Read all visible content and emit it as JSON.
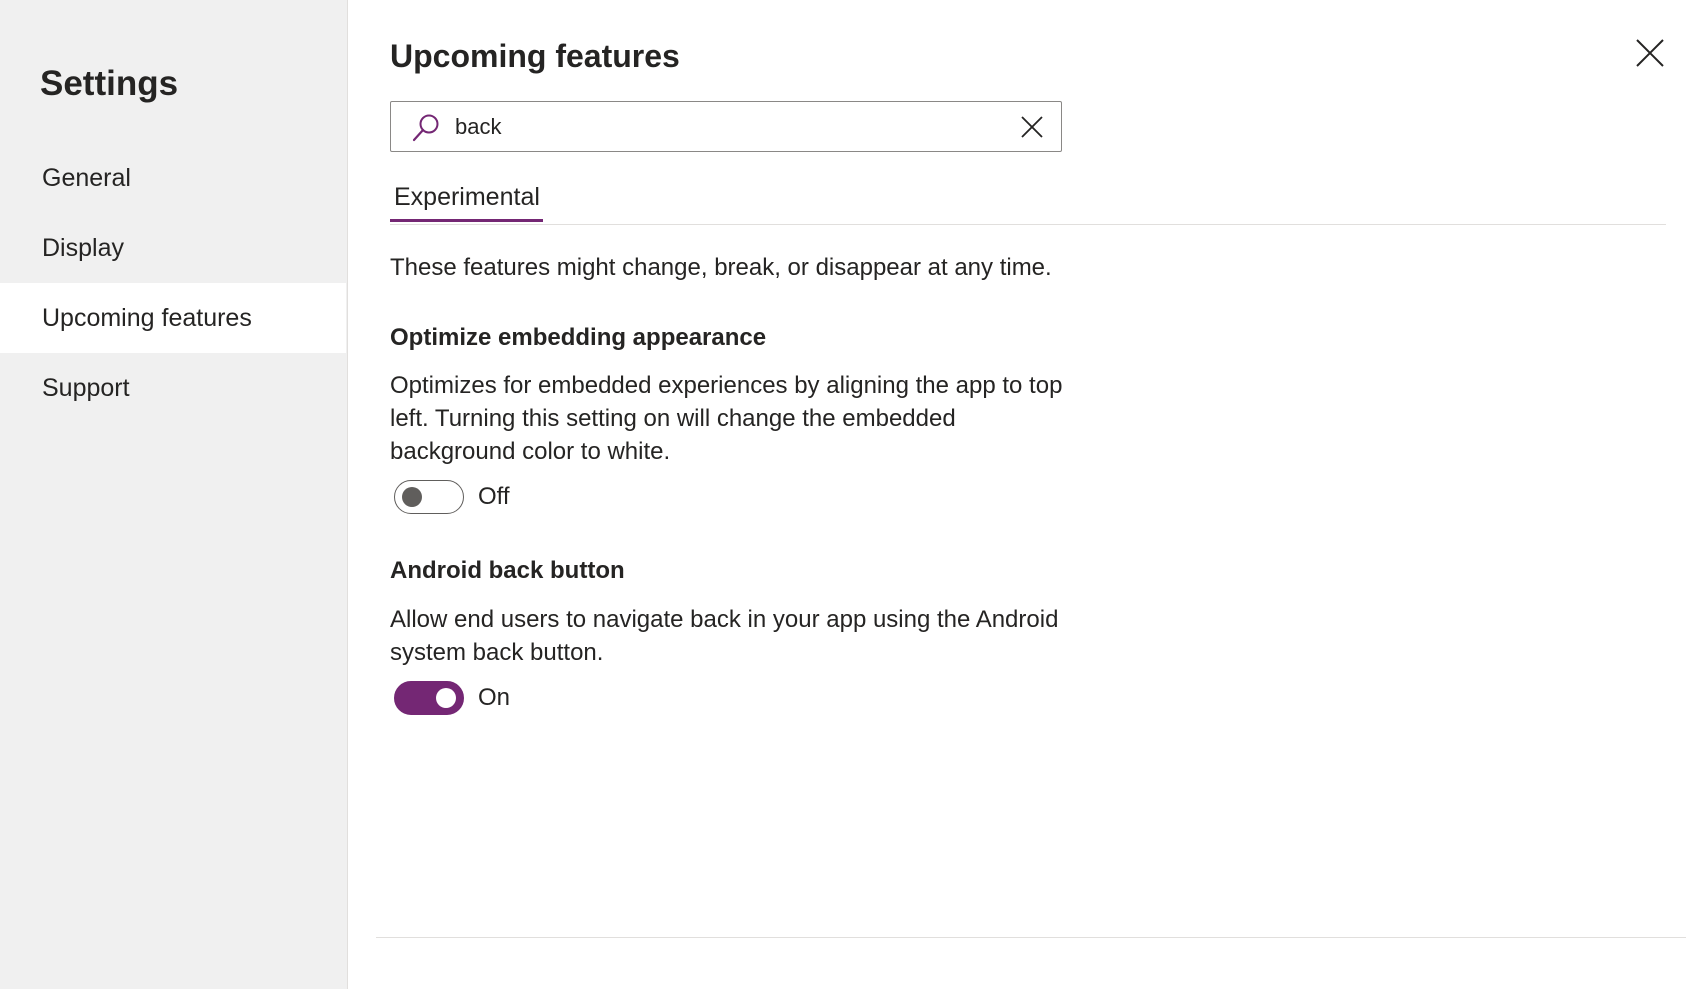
{
  "sidebar": {
    "title": "Settings",
    "items": [
      {
        "label": "General",
        "selected": false
      },
      {
        "label": "Display",
        "selected": false
      },
      {
        "label": "Upcoming features",
        "selected": true
      },
      {
        "label": "Support",
        "selected": false
      }
    ]
  },
  "main": {
    "title": "Upcoming features",
    "close_icon": "close-icon",
    "search": {
      "value": "back",
      "icon": "search-icon",
      "clear_icon": "clear-icon"
    },
    "tabs": [
      {
        "label": "Experimental",
        "selected": true
      }
    ],
    "intro": "These features might change, break, or disappear at any time.",
    "features": [
      {
        "title": "Optimize embedding appearance",
        "description": "Optimizes for embedded experiences by aligning the app to top left. Turning this setting on will change the embedded background color to white.",
        "toggle_on": false,
        "toggle_label": "Off"
      },
      {
        "title": "Android back button",
        "description": "Allow end users to navigate back in your app using the Android system back button.",
        "toggle_on": true,
        "toggle_label": "On"
      }
    ]
  },
  "colors": {
    "accent": "#742774",
    "sidebar_bg": "#f0f0f0",
    "text": "#252423"
  }
}
